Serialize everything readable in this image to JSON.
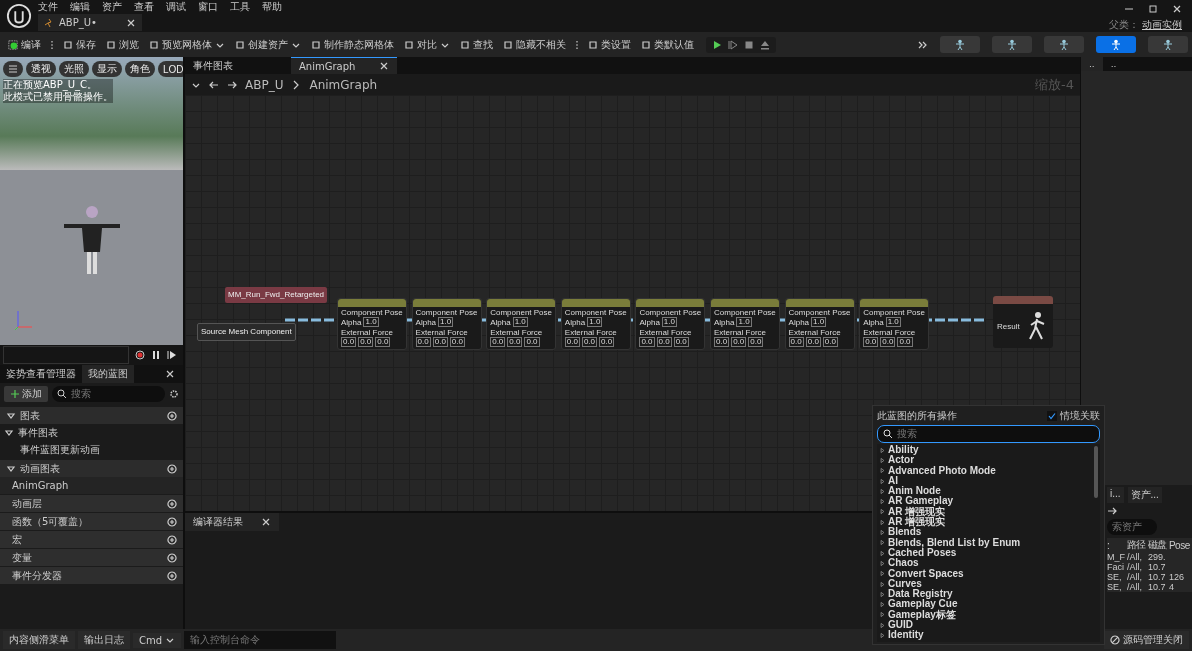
{
  "menu": [
    "文件",
    "编辑",
    "资产",
    "查看",
    "调试",
    "窗口",
    "工具",
    "帮助"
  ],
  "document_tab": {
    "label": "ABP_U•"
  },
  "parent_class": {
    "label": "父类：",
    "value": "动画实例"
  },
  "toolbar": [
    {
      "label": "编译",
      "kind": "compile"
    },
    {
      "label": "保存",
      "kind": "plain"
    },
    {
      "label": "浏览",
      "kind": "plain"
    },
    {
      "label": "预览网格体",
      "kind": "dropdown"
    },
    {
      "label": "创建资产",
      "kind": "dropdown"
    },
    {
      "label": "制作静态网格体",
      "kind": "plain"
    },
    {
      "label": "对比",
      "kind": "dropdown"
    },
    {
      "label": "查找",
      "kind": "plain"
    },
    {
      "label": "隐藏不相关",
      "kind": "plain"
    },
    {
      "label": "类设置",
      "kind": "plain"
    },
    {
      "label": "类默认值",
      "kind": "plain"
    }
  ],
  "mode_buttons": [
    {
      "selected": false
    },
    {
      "selected": false
    },
    {
      "selected": false
    },
    {
      "selected": true
    },
    {
      "selected": false
    }
  ],
  "viewport": {
    "buttons": [
      "透视",
      "光照",
      "显示",
      "角色",
      "LOD"
    ],
    "message": [
      "正在预览ABP_U_C。",
      "此模式已禁用骨骼操作。"
    ]
  },
  "editor_tabs": [
    {
      "label": "事件图表",
      "selected": false
    },
    {
      "label": "AnimGraph",
      "selected": true
    }
  ],
  "breadcrumb": [
    "ABP_U",
    "AnimGraph"
  ],
  "zoom_label": "缩放-4",
  "details_tabs": [
    {
      "label": "..",
      "selected": true
    },
    {
      "label": "..",
      "selected": false
    }
  ],
  "graph": {
    "inputs": [
      {
        "title": "MM_Run_Fwd_Retargeted",
        "color": "#7a3a44"
      },
      {
        "title": "Source Mesh Component",
        "color": "#2a2a2a"
      }
    ],
    "pose_nodes": [
      {
        "pose": "Component Pose",
        "alpha_label": "Alpha",
        "alpha": "1.0",
        "force_label": "External Force",
        "force": [
          "0.0",
          "0.0",
          "0.0"
        ]
      },
      {
        "pose": "Component Pose",
        "alpha_label": "Alpha",
        "alpha": "1.0",
        "force_label": "External Force",
        "force": [
          "0.0",
          "0.0",
          "0.0"
        ]
      },
      {
        "pose": "Component Pose",
        "alpha_label": "Alpha",
        "alpha": "1.0",
        "force_label": "External Force",
        "force": [
          "0.0",
          "0.0",
          "0.0"
        ]
      },
      {
        "pose": "Component Pose",
        "alpha_label": "Alpha",
        "alpha": "1.0",
        "force_label": "External Force",
        "force": [
          "0.0",
          "0.0",
          "0.0"
        ]
      },
      {
        "pose": "Component Pose",
        "alpha_label": "Alpha",
        "alpha": "1.0",
        "force_label": "External Force",
        "force": [
          "0.0",
          "0.0",
          "0.0"
        ]
      },
      {
        "pose": "Component Pose",
        "alpha_label": "Alpha",
        "alpha": "1.0",
        "force_label": "External Force",
        "force": [
          "0.0",
          "0.0",
          "0.0"
        ]
      },
      {
        "pose": "Component Pose",
        "alpha_label": "Alpha",
        "alpha": "1.0",
        "force_label": "External Force",
        "force": [
          "0.0",
          "0.0",
          "0.0"
        ]
      },
      {
        "pose": "Component Pose",
        "alpha_label": "Alpha",
        "alpha": "1.0",
        "force_label": "External Force",
        "force": [
          "0.0",
          "0.0",
          "0.0"
        ]
      }
    ],
    "result": {
      "pin": "Result"
    }
  },
  "panel_tabs": [
    {
      "label": "姿势查看管理器",
      "selected": false
    },
    {
      "label": "我的蓝图",
      "selected": true
    }
  ],
  "add_button": "添加",
  "search_placeholder": "搜索",
  "sections": [
    {
      "label": "图表",
      "kind": "header",
      "expanded": true
    },
    {
      "label": "事件图表",
      "kind": "tree",
      "expanded": true
    },
    {
      "label": "事件蓝图更新动画",
      "kind": "leaf"
    },
    {
      "label": "动画图表",
      "kind": "header",
      "expanded": true
    },
    {
      "label": "AnimGraph",
      "kind": "anim"
    },
    {
      "label": "动画层",
      "kind": "category"
    },
    {
      "label": "函数（5可覆盖）",
      "kind": "category"
    },
    {
      "label": "宏",
      "kind": "category"
    },
    {
      "label": "变量",
      "kind": "category"
    },
    {
      "label": "事件分发器",
      "kind": "category"
    }
  ],
  "compiler_tab": "编译器结果",
  "assets": {
    "tabs": [
      "i...",
      "资产..."
    ],
    "search_placeholder": "索资产",
    "columns": [
      ":",
      "路径",
      "磁盘",
      "Pose"
    ],
    "rows": [
      [
        "M_F",
        "/All,",
        "299.",
        ""
      ],
      [
        "Faci",
        "/All,",
        "10.7",
        ""
      ],
      [
        "SE,",
        "/All,",
        "10.7",
        "126"
      ],
      [
        "SE,",
        "/All,",
        "10.7",
        "4"
      ]
    ]
  },
  "action_menu": {
    "title": "此蓝图的所有操作",
    "context_label": "情境关联",
    "context_checked": true,
    "search_placeholder": "搜索",
    "items": [
      "Ability",
      "Actor",
      "Advanced Photo Mode",
      "AI",
      "Anim Node",
      "AR Gameplay",
      "AR 增强现实",
      "AR 增强现实",
      "Blends",
      "Blends, Blend List by Enum",
      "Cached Poses",
      "Chaos",
      "Convert Spaces",
      "Curves",
      "Data Registry",
      "Gameplay Cue",
      "Gameplay标签",
      "GUID",
      "Identity"
    ]
  },
  "status_bar": {
    "content_drawer": "内容侧滑菜单",
    "output_log": "输出日志",
    "cmd": "Cmd",
    "console_placeholder": "输入控制台命令",
    "source_control": "源码管理关闭"
  }
}
